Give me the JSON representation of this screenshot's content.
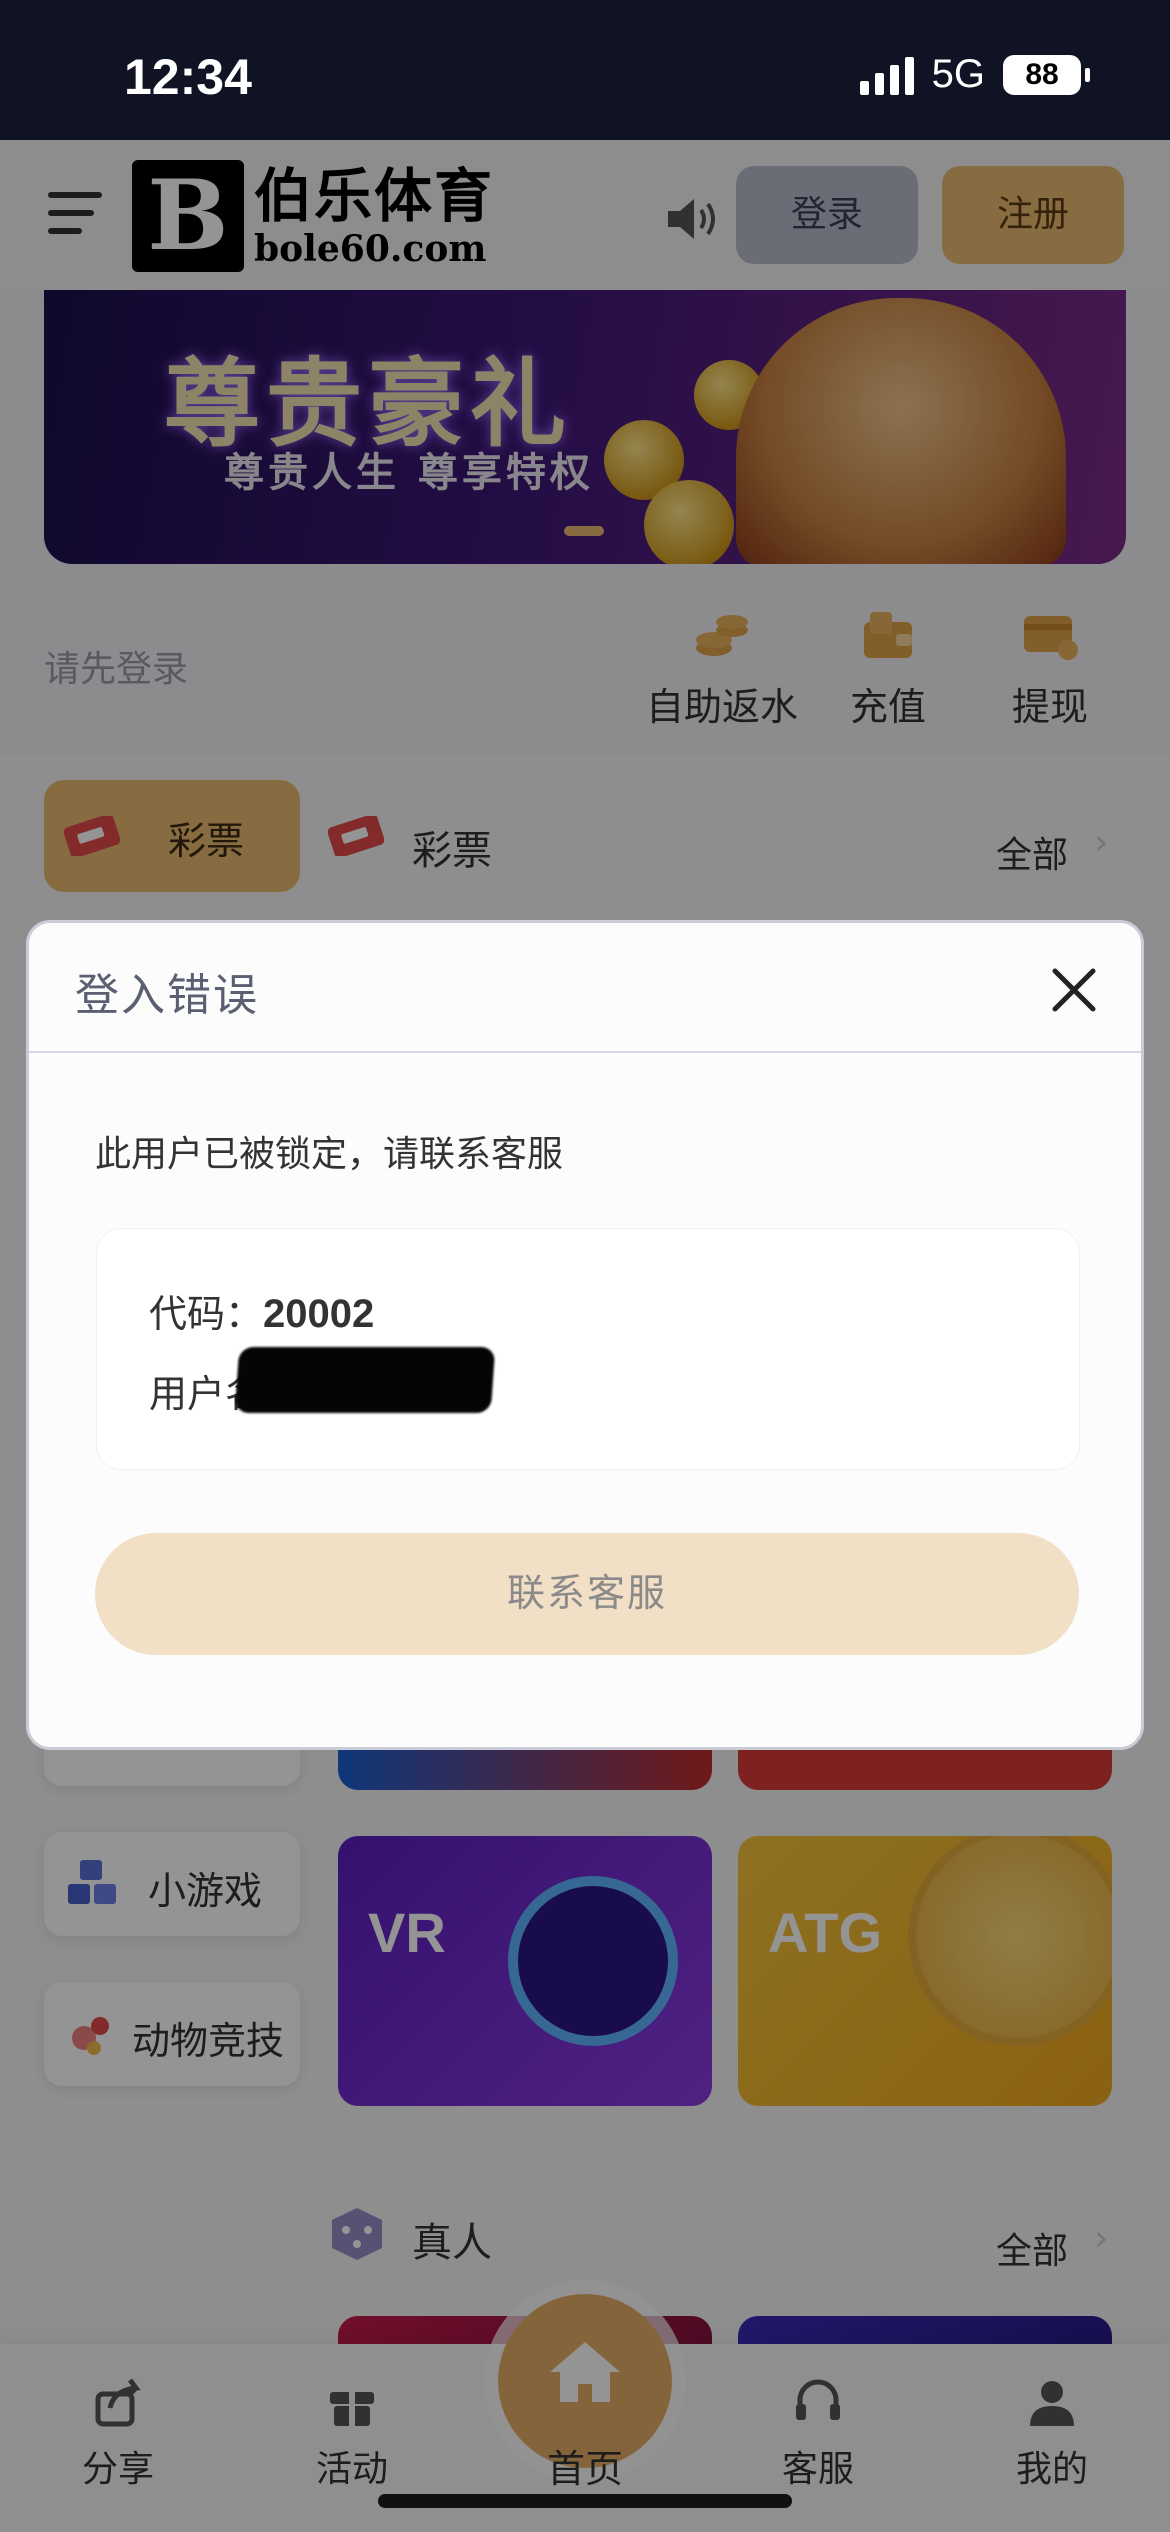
{
  "status_bar": {
    "time": "12:34",
    "network": "5G",
    "battery": "88"
  },
  "header": {
    "logo_letter": "B",
    "logo_name": "伯乐体育",
    "logo_url": "bole60.com",
    "login_label": "登录",
    "register_label": "注册"
  },
  "banner": {
    "title": "尊贵豪礼",
    "subtitle": "尊贵人生  尊享特权"
  },
  "account_row": {
    "prompt": "请先登录",
    "actions": [
      {
        "label": "自助返水",
        "icon": "coins-stack-icon"
      },
      {
        "label": "充值",
        "icon": "wallet-icon"
      },
      {
        "label": "提现",
        "icon": "card-withdraw-icon"
      }
    ]
  },
  "categories": {
    "active_label": "彩票",
    "section_title": "彩票",
    "all_label": "全部",
    "side_items": [
      {
        "label": "小游戏",
        "icon": "cubes-icon"
      },
      {
        "label": "动物竞技",
        "icon": "pinwheel-icon"
      }
    ],
    "tiles": [
      {
        "label": "VR"
      },
      {
        "label": "ATG"
      }
    ],
    "live_title": "真人",
    "live_all_label": "全部"
  },
  "bottom_nav": {
    "items": [
      {
        "label": "分享",
        "icon": "share-icon"
      },
      {
        "label": "活动",
        "icon": "gift-icon"
      },
      {
        "label": "首页",
        "icon": "home-icon"
      },
      {
        "label": "客服",
        "icon": "headset-icon"
      },
      {
        "label": "我的",
        "icon": "user-icon"
      }
    ]
  },
  "modal": {
    "title": "登入错误",
    "message": "此用户已被锁定，请联系客服",
    "code_label": "代码：",
    "code_value": "20002",
    "username_label": "用户名",
    "button_label": "联系客服"
  },
  "colors": {
    "accent_gold": "#e8b870",
    "login_button": "#b8bccb",
    "status_bar": "#0f1324",
    "contact_button": "#f1dfc6"
  }
}
